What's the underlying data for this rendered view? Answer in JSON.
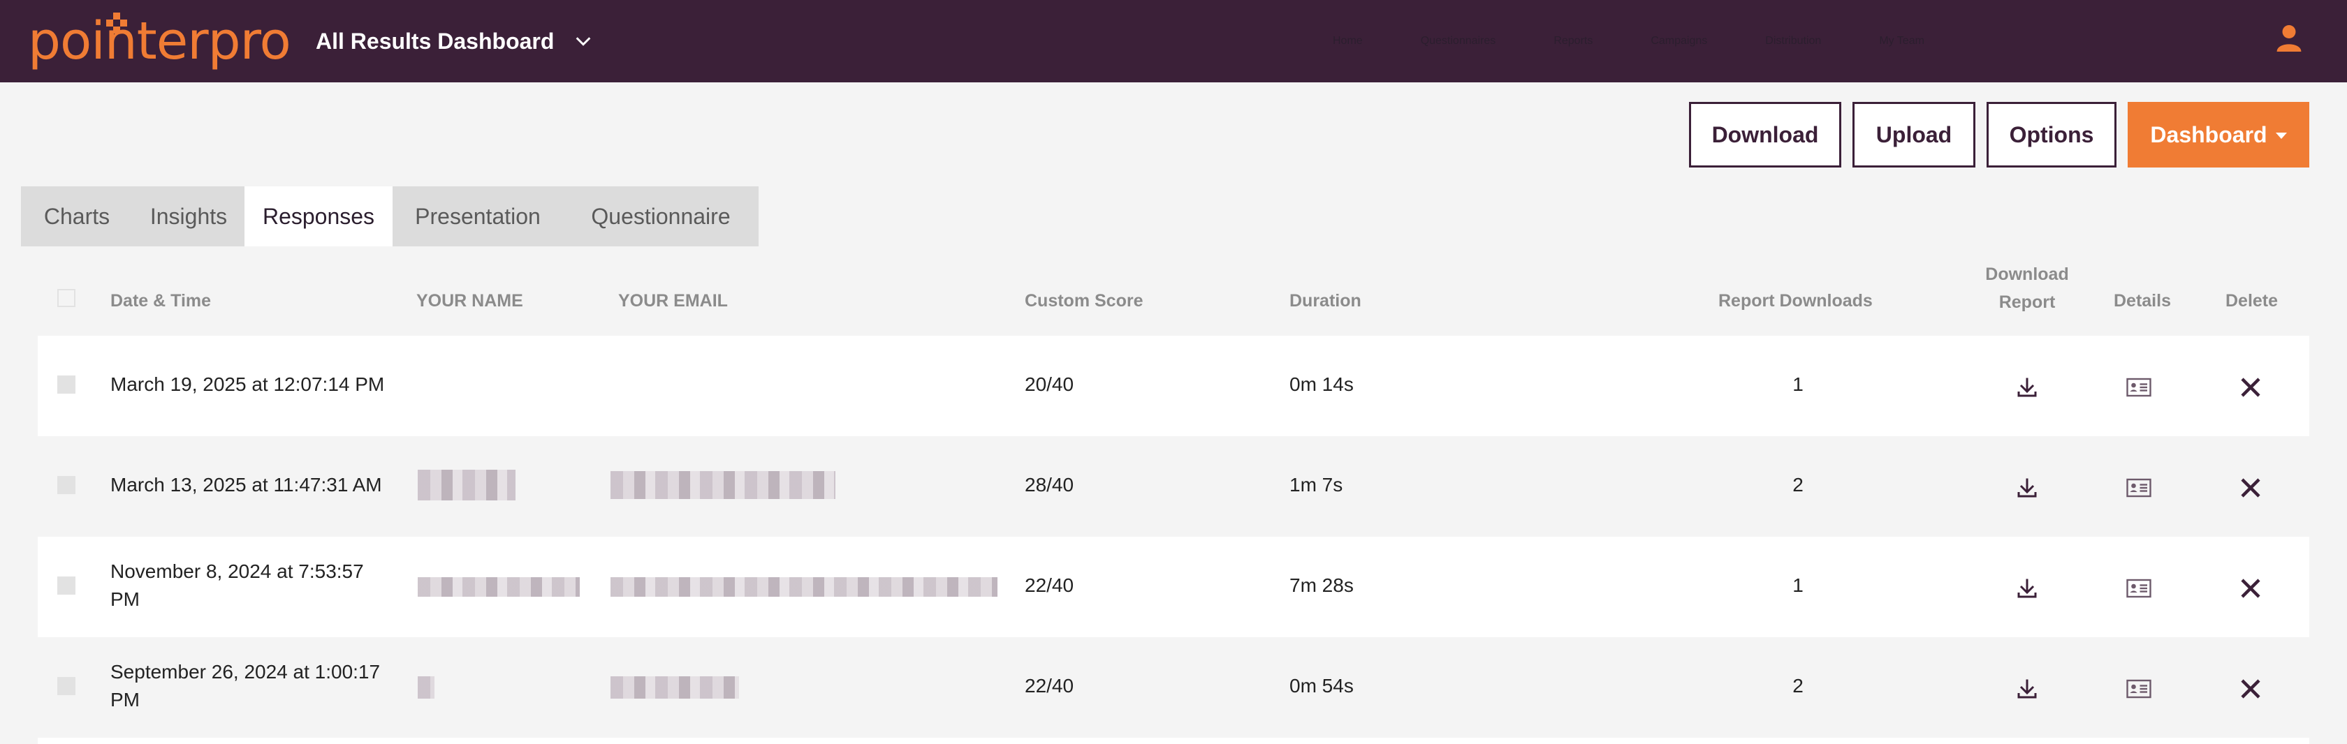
{
  "app": {
    "logo_text": "pointerpro",
    "dashboard_title": "All Results Dashboard"
  },
  "nav": {
    "items": [
      "Home",
      "Questionnaires",
      "Reports",
      "Campaigns",
      "Distribution",
      "My Team"
    ]
  },
  "actions": {
    "download": "Download",
    "upload": "Upload",
    "options": "Options",
    "dashboard": "Dashboard"
  },
  "tabs": [
    "Charts",
    "Insights",
    "Responses",
    "Presentation",
    "Questionnaire"
  ],
  "active_tab": "Responses",
  "table": {
    "headers": {
      "date": "Date & Time",
      "name": "YOUR NAME",
      "email": "YOUR EMAIL",
      "score": "Custom Score",
      "duration": "Duration",
      "downloads": "Report Downloads",
      "download_report_1": "Download",
      "download_report_2": "Report",
      "details": "Details",
      "delete": "Delete"
    },
    "rows": [
      {
        "date_line1": "March 19, 2025 at 12:07:14 PM",
        "date_line2": "",
        "score": "20/40",
        "duration": "0m 14s",
        "downloads": "1"
      },
      {
        "date_line1": "March 13, 2025 at 11:47:31 AM",
        "date_line2": "",
        "score": "28/40",
        "duration": "1m 7s",
        "downloads": "2"
      },
      {
        "date_line1": "November 8, 2024 at 7:53:57",
        "date_line2": "PM",
        "score": "22/40",
        "duration": "7m 28s",
        "downloads": "1"
      },
      {
        "date_line1": "September 26, 2024 at 1:00:17",
        "date_line2": "PM",
        "score": "22/40",
        "duration": "0m 54s",
        "downloads": "2"
      }
    ]
  },
  "colors": {
    "topbar": "#3b2038",
    "accent": "#f07c34"
  },
  "icons": {
    "chevron": "chevron-down-icon",
    "user": "user-icon",
    "download": "download-icon",
    "details": "id-card-icon",
    "delete": "close-icon"
  }
}
